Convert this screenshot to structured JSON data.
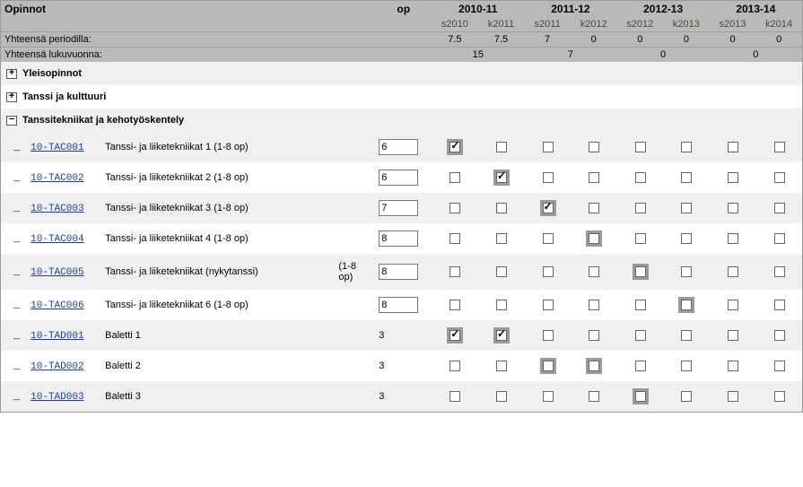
{
  "header": {
    "title": "Opinnot",
    "op_label": "op",
    "years": [
      "2010-11",
      "2011-12",
      "2012-13",
      "2013-14"
    ],
    "periods": [
      "s2010",
      "k2011",
      "s2011",
      "k2012",
      "s2012",
      "k2013",
      "s2013",
      "k2014"
    ],
    "row_period_label": "Yhteensä periodilla:",
    "row_year_label": "Yhteensä lukuvuonna:",
    "period_totals": [
      "7.5",
      "7.5",
      "7",
      "0",
      "0",
      "0",
      "0",
      "0"
    ],
    "year_totals": [
      "15",
      "7",
      "0",
      "0"
    ]
  },
  "sections": [
    {
      "icon": "+",
      "label": "Yleisopinnot"
    },
    {
      "icon": "+",
      "label": "Tanssi ja kulttuuri"
    },
    {
      "icon": "−",
      "label": "Tanssitekniikat ja kehotyöskentely"
    }
  ],
  "courses": [
    {
      "code": "10-TAC001",
      "name": "Tanssi- ja liiketekniikat 1 (1-8 op)",
      "extra": "",
      "op_editable": true,
      "op": "6",
      "checks": [
        true,
        false,
        false,
        false,
        false,
        false,
        false,
        false
      ],
      "hl": [
        true,
        false,
        false,
        false,
        false,
        false,
        false,
        false
      ]
    },
    {
      "code": "10-TAC002",
      "name": "Tanssi- ja liiketekniikat 2 (1-8 op)",
      "extra": "",
      "op_editable": true,
      "op": "6",
      "checks": [
        false,
        true,
        false,
        false,
        false,
        false,
        false,
        false
      ],
      "hl": [
        false,
        true,
        false,
        false,
        false,
        false,
        false,
        false
      ]
    },
    {
      "code": "10-TAC003",
      "name": "Tanssi- ja liiketekniikat 3 (1-8 op)",
      "extra": "",
      "op_editable": true,
      "op": "7",
      "checks": [
        false,
        false,
        true,
        false,
        false,
        false,
        false,
        false
      ],
      "hl": [
        false,
        false,
        true,
        false,
        false,
        false,
        false,
        false
      ]
    },
    {
      "code": "10-TAC004",
      "name": "Tanssi- ja liiketekniikat 4 (1-8 op)",
      "extra": "",
      "op_editable": true,
      "op": "8",
      "checks": [
        false,
        false,
        false,
        false,
        false,
        false,
        false,
        false
      ],
      "hl": [
        false,
        false,
        false,
        true,
        false,
        false,
        false,
        false
      ]
    },
    {
      "code": "10-TAC005",
      "name": "Tanssi- ja liiketekniikat (nykytanssi)",
      "extra": "(1-8 op)",
      "op_editable": true,
      "op": "8",
      "checks": [
        false,
        false,
        false,
        false,
        false,
        false,
        false,
        false
      ],
      "hl": [
        false,
        false,
        false,
        false,
        true,
        false,
        false,
        false
      ]
    },
    {
      "code": "10-TAC006",
      "name": "Tanssi- ja liiketekniikat 6 (1-8 op)",
      "extra": "",
      "op_editable": true,
      "op": "8",
      "checks": [
        false,
        false,
        false,
        false,
        false,
        false,
        false,
        false
      ],
      "hl": [
        false,
        false,
        false,
        false,
        false,
        true,
        false,
        false
      ]
    },
    {
      "code": "10-TAD001",
      "name": "Baletti 1",
      "extra": "",
      "op_editable": false,
      "op": "3",
      "checks": [
        true,
        true,
        false,
        false,
        false,
        false,
        false,
        false
      ],
      "hl": [
        true,
        true,
        false,
        false,
        false,
        false,
        false,
        false
      ]
    },
    {
      "code": "10-TAD002",
      "name": "Baletti 2",
      "extra": "",
      "op_editable": false,
      "op": "3",
      "checks": [
        false,
        false,
        false,
        false,
        false,
        false,
        false,
        false
      ],
      "hl": [
        false,
        false,
        true,
        true,
        false,
        false,
        false,
        false
      ]
    },
    {
      "code": "10-TAD003",
      "name": "Baletti 3",
      "extra": "",
      "op_editable": false,
      "op": "3",
      "checks": [
        false,
        false,
        false,
        false,
        false,
        false,
        false,
        false
      ],
      "hl": [
        false,
        false,
        false,
        false,
        true,
        false,
        false,
        false
      ]
    }
  ]
}
